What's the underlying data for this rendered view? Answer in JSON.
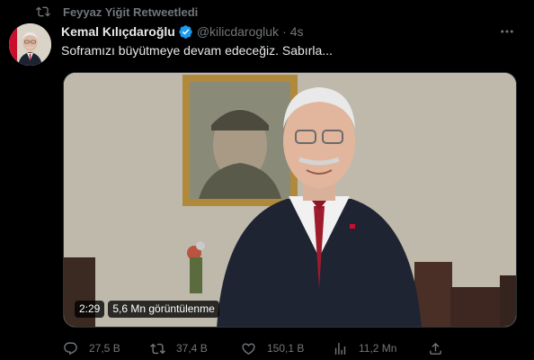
{
  "retweet": {
    "label": "Feyyaz Yiğit Retweetledi"
  },
  "tweet": {
    "author_name": "Kemal Kılıçdaroğlu",
    "handle": "@kilicdarogluk",
    "separator": "·",
    "time": "4s",
    "text": "Soframızı büyütmeye devam edeceğiz. Sabırla..."
  },
  "video": {
    "duration": "2:29",
    "views": "5,6 Mn görüntülenme"
  },
  "actions": {
    "replies": "27,5 B",
    "retweets": "37,4 B",
    "likes": "150,1 B",
    "views": "11,2 Mn"
  },
  "colors": {
    "background": "#000000",
    "text_primary": "#e7e9ea",
    "text_secondary": "#71767b",
    "verified": "#1d9bf0"
  },
  "icons": [
    "retweet-icon",
    "verified-badge-icon",
    "more-icon",
    "reply-icon",
    "like-icon",
    "views-icon",
    "share-icon"
  ]
}
